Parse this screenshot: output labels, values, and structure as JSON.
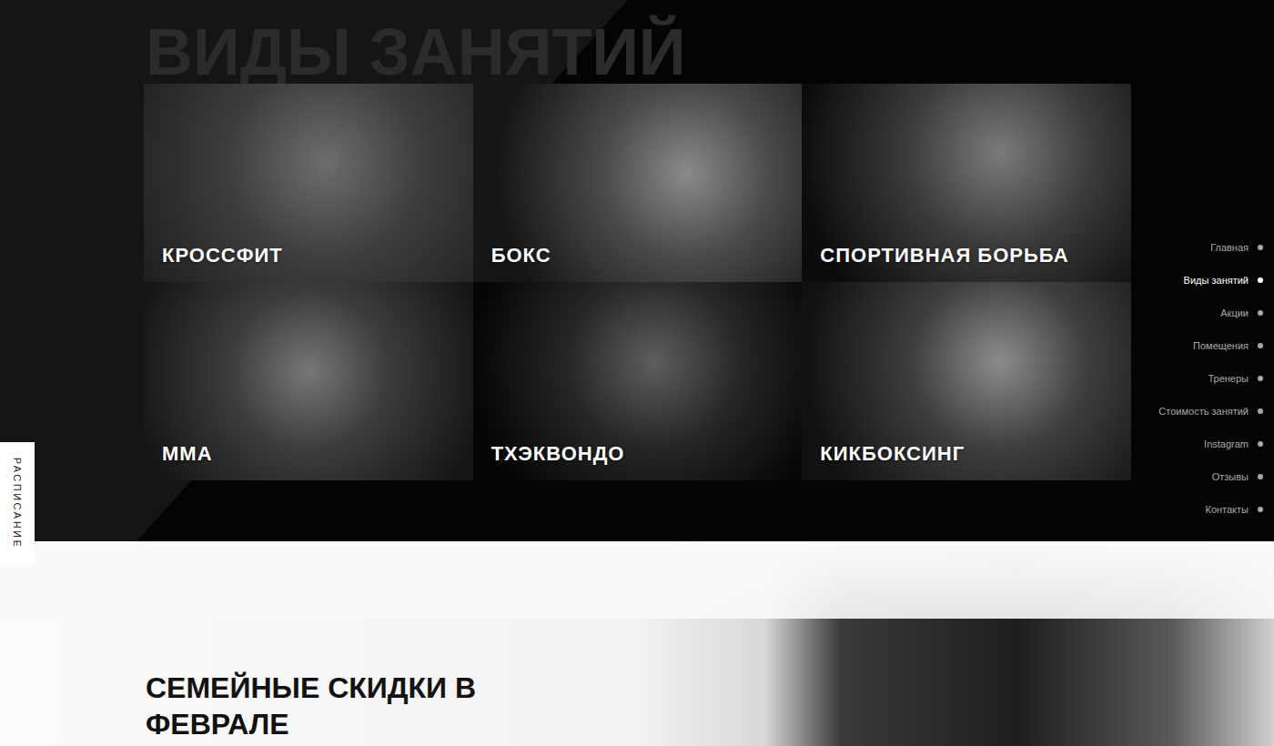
{
  "section": {
    "heading": "ВИДЫ ЗАНЯТИЙ"
  },
  "classes": [
    {
      "label": "КРОССФИТ"
    },
    {
      "label": "БОКС"
    },
    {
      "label": "СПОРТИВНАЯ БОРЬБА"
    },
    {
      "label": "ММА"
    },
    {
      "label": "ТХЭКВОНДО"
    },
    {
      "label": "КИКБОКСИНГ"
    }
  ],
  "nav": [
    {
      "label": "Главная",
      "selected": false
    },
    {
      "label": "Виды занятий",
      "selected": true
    },
    {
      "label": "Акции",
      "selected": false
    },
    {
      "label": "Помещения",
      "selected": false
    },
    {
      "label": "Тренеры",
      "selected": false
    },
    {
      "label": "Стоимость занятий",
      "selected": false
    },
    {
      "label": "Instagram",
      "selected": false
    },
    {
      "label": "Отзывы",
      "selected": false
    },
    {
      "label": "Контакты",
      "selected": false
    }
  ],
  "schedule_tab": {
    "label": "РАСПИСАНИЕ"
  },
  "promo": {
    "title": "СЕМЕЙНЫЕ СКИДКИ В ФЕВРАЛЕ"
  }
}
